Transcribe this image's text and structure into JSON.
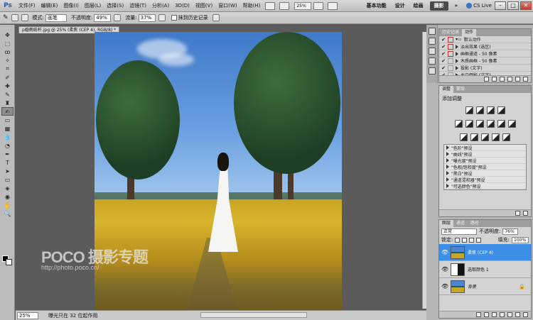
{
  "menubar": {
    "logo": "Ps",
    "items": [
      "文件(F)",
      "编辑(E)",
      "图像(I)",
      "图层(L)",
      "选择(S)",
      "滤镜(T)",
      "分析(A)",
      "3D(D)",
      "视图(V)",
      "窗口(W)",
      "帮助(H)"
    ],
    "zoom": "25%",
    "workspaces": [
      "基本功能",
      "设计",
      "绘画",
      "摄影"
    ],
    "active_workspace": "摄影",
    "cs_live": "CS Live",
    "expand": "»"
  },
  "options": {
    "mode_label": "模式:",
    "mode_value": "画笔",
    "opacity_label": "不透明度:",
    "opacity_value": "49%",
    "flow_label": "流量:",
    "flow_value": "37%",
    "erase_history_label": "抹到历史记录"
  },
  "document": {
    "tab_title": "p婚雨纸杆.jpg @ 25% (柔焦 (CEP 4), RGB/8) *",
    "watermark_brand": "POCO 摄影专题",
    "watermark_url": "http://photo.poco.cn/"
  },
  "ime": {
    "logo": "S",
    "lang": "中"
  },
  "status": {
    "zoom": "25%",
    "text": "曝光只在 32 位起作用"
  },
  "history_panel": {
    "tabs": [
      "历史记录",
      "动作"
    ],
    "active_tab": "动作",
    "set_name": "默认动作",
    "actions": [
      "淡出效果 (选区)",
      "画框通道 - 50 像素",
      "木质画框 - 50 像素",
      "投影 (文字)",
      "水中倒影 (文字)"
    ]
  },
  "adjust_panel": {
    "tabs": [
      "调整",
      "蒙版"
    ],
    "title": "添加调整",
    "presets": [
      "\"色阶\"预设",
      "\"曲线\"预设",
      "\"曝光度\"预设",
      "\"色相/饱和度\"预设",
      "\"黑白\"预设",
      "\"通道混和器\"预设",
      "\"可选颜色\"预设"
    ]
  },
  "layers_panel": {
    "tabs": [
      "图层",
      "通道",
      "路径"
    ],
    "blend_mode": "正常",
    "opacity_label": "不透明度:",
    "opacity_value": "76%",
    "lock_label": "锁定:",
    "fill_label": "填充:",
    "fill_value": "100%",
    "layers": [
      {
        "name": "柔焦 (CEP 4)",
        "selected": true
      },
      {
        "name": "选取颜色 1",
        "selected": false
      },
      {
        "name": "背景",
        "selected": false
      }
    ]
  }
}
